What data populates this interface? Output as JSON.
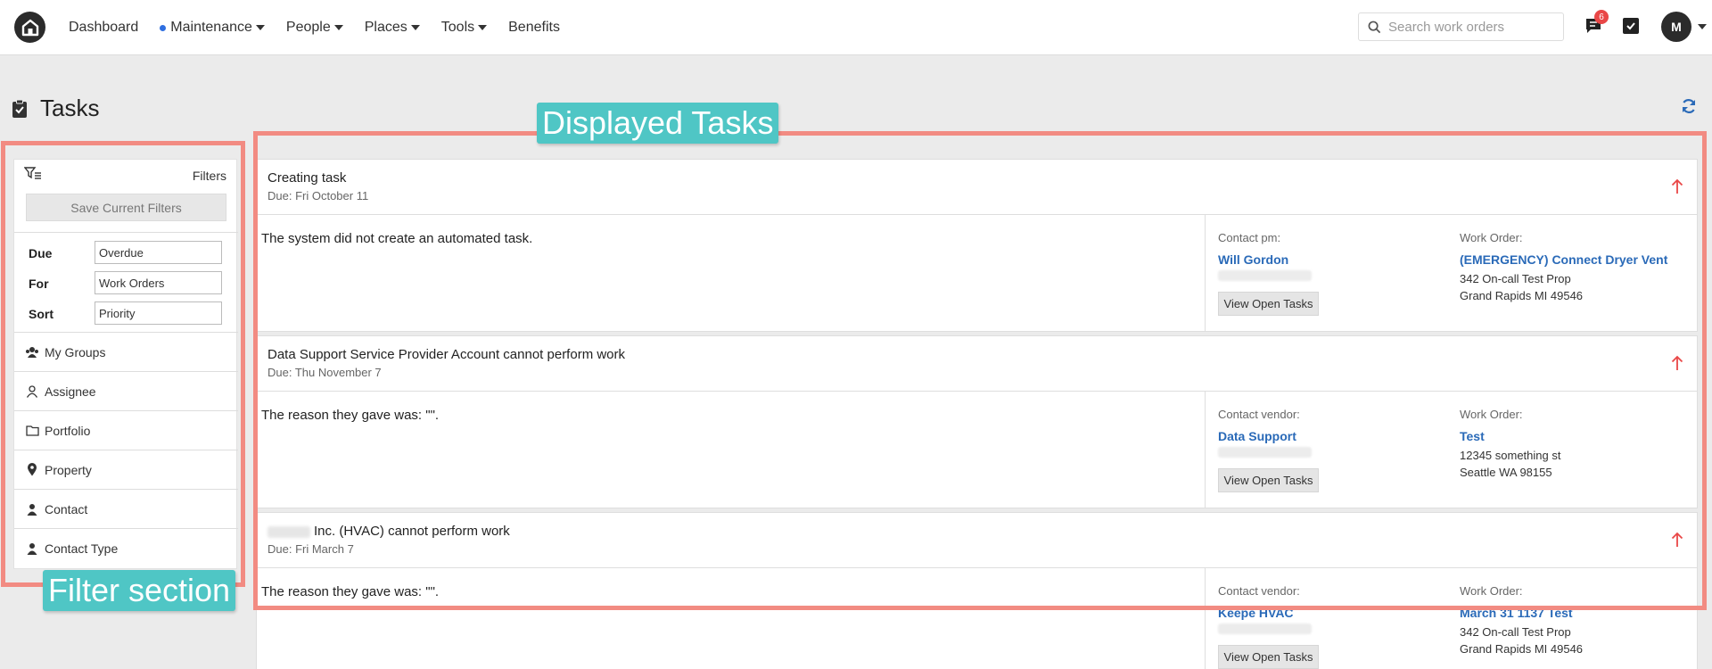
{
  "nav": {
    "items": [
      {
        "label": "Dashboard",
        "has_dot": false,
        "has_caret": false
      },
      {
        "label": "Maintenance",
        "has_dot": true,
        "has_caret": true
      },
      {
        "label": "People",
        "has_dot": false,
        "has_caret": true
      },
      {
        "label": "Places",
        "has_dot": false,
        "has_caret": true
      },
      {
        "label": "Tools",
        "has_dot": false,
        "has_caret": true
      },
      {
        "label": "Benefits",
        "has_dot": false,
        "has_caret": false
      }
    ],
    "search_placeholder": "Search work orders",
    "notification_count": "6",
    "avatar_initial": "M",
    "accent_color": "#2f6fe0",
    "badge_color": "#e94747"
  },
  "page": {
    "title": "Tasks",
    "icons": [
      "clipboard-check-icon",
      "refresh-icon"
    ]
  },
  "annotations": {
    "filter_section": "Filter section",
    "displayed_tasks": "Displayed Tasks",
    "color": "#f28b82",
    "label_color": "#4fc6c5"
  },
  "filters": {
    "header_label": "Filters",
    "save_button": "Save Current Filters",
    "rows": [
      {
        "label": "Due",
        "value": "Overdue"
      },
      {
        "label": "For",
        "value": "Work Orders"
      },
      {
        "label": "Sort",
        "value": "Priority"
      }
    ],
    "items": [
      {
        "label": "My Groups",
        "icon": "group-icon"
      },
      {
        "label": "Assignee",
        "icon": "person-outline-icon"
      },
      {
        "label": "Portfolio",
        "icon": "folder-icon"
      },
      {
        "label": "Property",
        "icon": "map-pin-icon"
      },
      {
        "label": "Contact",
        "icon": "person-icon"
      },
      {
        "label": "Contact Type",
        "icon": "person-icon"
      }
    ]
  },
  "tasks": [
    {
      "title": "Creating task",
      "due": "Due: Fri October 11",
      "description": "The system did not create an automated task.",
      "contact_label": "Contact pm:",
      "contact_name": "Will Gordon",
      "view_button": "View Open Tasks",
      "wo_label": "Work Order:",
      "wo_title": "(EMERGENCY) Connect Dryer Vent",
      "wo_address1": "342 On-call Test Prop",
      "wo_address2": "Grand Rapids MI 49546"
    },
    {
      "title": "Data Support Service Provider Account cannot perform work",
      "due": "Due: Thu November 7",
      "description": "The reason they gave was: \"\".",
      "contact_label": "Contact vendor:",
      "contact_name": "Data Support",
      "view_button": "View Open Tasks",
      "wo_label": "Work Order:",
      "wo_title": "Test",
      "wo_address1": "12345 something st",
      "wo_address2": "Seattle WA 98155"
    },
    {
      "title": "Inc. (HVAC) cannot perform work",
      "due": "Due: Fri March 7",
      "description": "The reason they gave was: \"\".",
      "contact_label": "Contact vendor:",
      "contact_name": "Keepe HVAC",
      "view_button": "View Open Tasks",
      "wo_label": "Work Order:",
      "wo_title": "March 31 1137 Test",
      "wo_address1": "342 On-call Test Prop",
      "wo_address2": "Grand Rapids MI 49546"
    }
  ]
}
